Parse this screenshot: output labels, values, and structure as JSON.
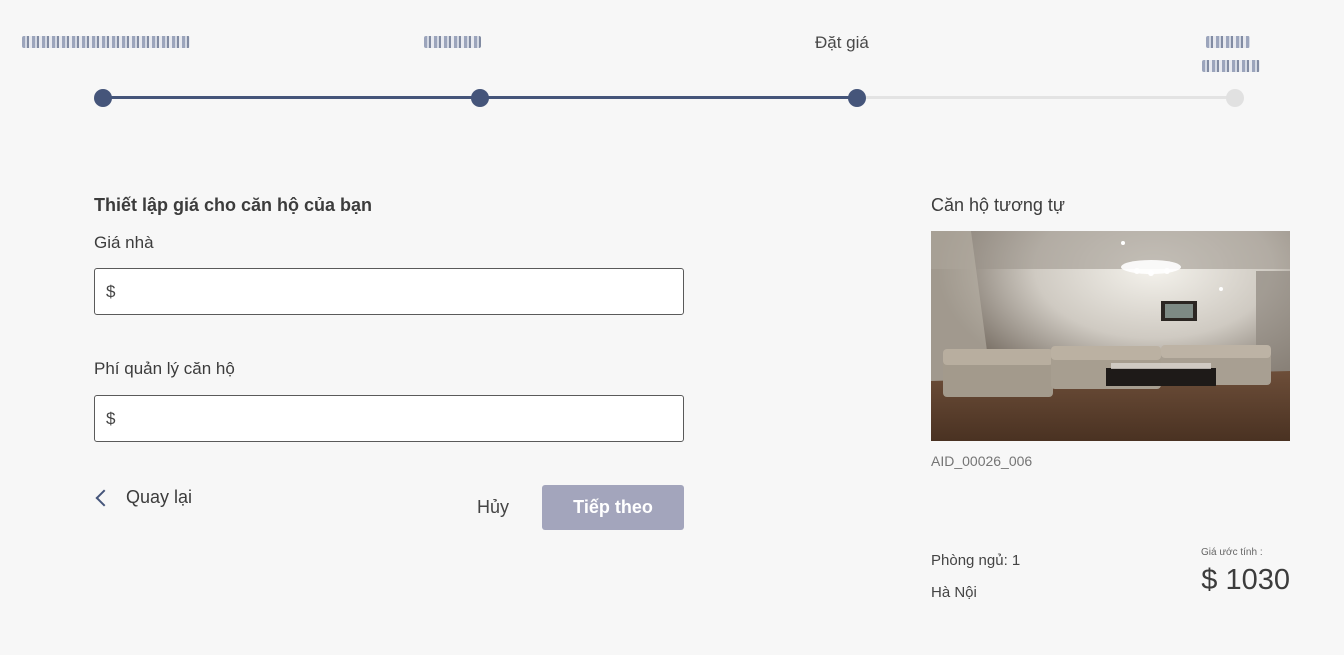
{
  "stepper": {
    "steps": [
      {
        "label": "",
        "state": "completed"
      },
      {
        "label": "",
        "state": "completed"
      },
      {
        "label": "Đặt giá",
        "state": "current"
      },
      {
        "label": "",
        "state": "pending"
      }
    ]
  },
  "form": {
    "heading": "Thiết lập giá cho căn hộ của bạn",
    "price_label": "Giá nhà",
    "price_currency": "$",
    "price_value": "",
    "fee_label": "Phí quản lý căn hộ",
    "fee_currency": "$",
    "fee_value": "",
    "back_label": "Quay lại",
    "cancel_label": "Hủy",
    "next_label": "Tiếp theo"
  },
  "similar": {
    "title": "Căn hộ tương tự",
    "apartment_id": "AID_00026_006",
    "bedrooms": "Phòng ngủ: 1",
    "city": "Hà Nội",
    "estimate_label": "Giá ước tính :",
    "estimate_price": "$ 1030"
  },
  "colors": {
    "accent": "#45557a",
    "track_inactive": "#e3e3e3",
    "next_button": "#a3a5bc",
    "background": "#f7f7f7"
  }
}
